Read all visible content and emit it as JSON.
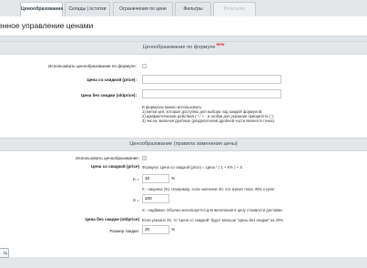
{
  "tabs": [
    {
      "label": "Ценообразование",
      "active": true,
      "disabled": false
    },
    {
      "label": "Склады | остатки",
      "active": false,
      "disabled": false
    },
    {
      "label": "Ограничения по цене",
      "active": false,
      "disabled": false
    },
    {
      "label": "Фильтры",
      "active": false,
      "disabled": false
    },
    {
      "label": "Результат",
      "active": false,
      "disabled": true
    }
  ],
  "page_title": "енное управление ценами",
  "formula_section": {
    "title": "Ценообразование по формуле",
    "badge": "NEW",
    "use_label": "Использовать ценообразование по формуле:",
    "price_label": "Цена со скидкой (price):",
    "oldprice_label": "Цена без скидки (oldprice):",
    "help_lines": [
      "В формулах можно использовать:",
      "1) метки цен, которые доступны для выбора под каждой формулой;",
      "2) арифметические действия ( * / + - и скобки для указания приоритета ( );",
      "3) числа, включая дробные (разделителем дробной части является точка)."
    ]
  },
  "rules_section": {
    "title": "Ценообразование (правила изменения цены)",
    "use_label": "Использовать ценообразование:",
    "price_label": "Цена со скидкой (price)",
    "price_formula": "Формула: Цена со скидкой (price) = Цена * ( 1 + K% ) + S",
    "k_label": "K =",
    "k_value": "10",
    "k_unit": "%",
    "k_hint": "K - наценка (%). Например, если значение 30, это значит плюс 30% к цене",
    "s_label": "S =",
    "s_value": "100",
    "s_hint": "S - надбавка. Обычно используется для включения в цену стоимости доставки",
    "oldprice_label": "Цена без скидки (oldprice)",
    "oldprice_hint": "Если указано 20, то \"Цена со скидкой\" будет меньше \"Цены без скидки\" на 20%",
    "discount_label": "Размер скидки:",
    "discount_value": "20",
    "discount_unit": "%"
  },
  "save_button": "ть"
}
